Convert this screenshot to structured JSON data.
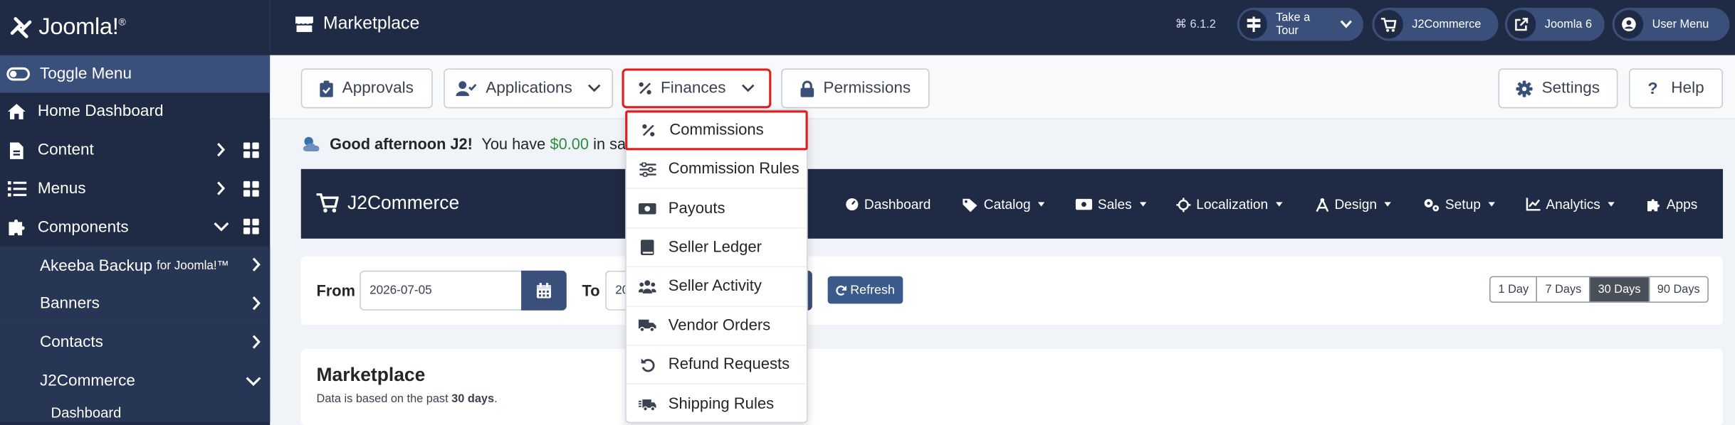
{
  "brand": {
    "name": "Joomla!",
    "trademark": "®"
  },
  "sidebar": {
    "toggle": "Toggle Menu",
    "items": [
      {
        "label": "Home Dashboard"
      },
      {
        "label": "Content"
      },
      {
        "label": "Menus"
      },
      {
        "label": "Components"
      }
    ],
    "sub_items": [
      {
        "label": "Akeeba Backup",
        "small": "for Joomla!™"
      },
      {
        "label": "Banners"
      },
      {
        "label": "Contacts"
      },
      {
        "label": "J2Commerce"
      }
    ],
    "sub_sub": "Dashboard"
  },
  "header": {
    "title": "Marketplace",
    "version": "6.1.2",
    "take_tour": "Take a Tour",
    "j2commerce": "J2Commerce",
    "joomla6": "Joomla 6",
    "user_menu": "User Menu"
  },
  "toolbar": {
    "approvals": "Approvals",
    "applications": "Applications",
    "finances": "Finances",
    "permissions": "Permissions",
    "settings": "Settings",
    "help": "Help"
  },
  "greeting": {
    "hello": "Good afternoon J2!",
    "pre": "You have",
    "amount": "$0.00",
    "post": "in sales"
  },
  "j2nav": {
    "title": "J2Commerce",
    "items": [
      "Dashboard",
      "Catalog",
      "Sales",
      "Localization",
      "Design",
      "Setup",
      "Analytics",
      "Apps"
    ]
  },
  "filters": {
    "from_label": "From",
    "from_value": "2026-07-05",
    "to_label": "To",
    "to_value": "20",
    "refresh": "Refresh",
    "ranges": [
      "1 Day",
      "7 Days",
      "30 Days",
      "90 Days"
    ],
    "selected_range": "30 Days"
  },
  "marketplace": {
    "heading": "Marketplace",
    "sub_pre": "Data is based on the past",
    "sub_bold": "30 days",
    "sub_post": "."
  },
  "finances_menu": [
    {
      "label": "Commissions",
      "icon": "percent-icon"
    },
    {
      "label": "Commission Rules",
      "icon": "sliders-icon"
    },
    {
      "label": "Payouts",
      "icon": "money-bill-icon"
    },
    {
      "label": "Seller Ledger",
      "icon": "book-icon"
    },
    {
      "label": "Seller Activity",
      "icon": "users-icon"
    },
    {
      "label": "Vendor Orders",
      "icon": "truck-icon"
    },
    {
      "label": "Refund Requests",
      "icon": "undo-icon"
    },
    {
      "label": "Shipping Rules",
      "icon": "shipping-fast-icon"
    }
  ],
  "colors": {
    "sidebar": "#1f2b44",
    "accent": "#3a4f7a",
    "highlight": "#e01d1d",
    "money": "#2e8b3d"
  }
}
